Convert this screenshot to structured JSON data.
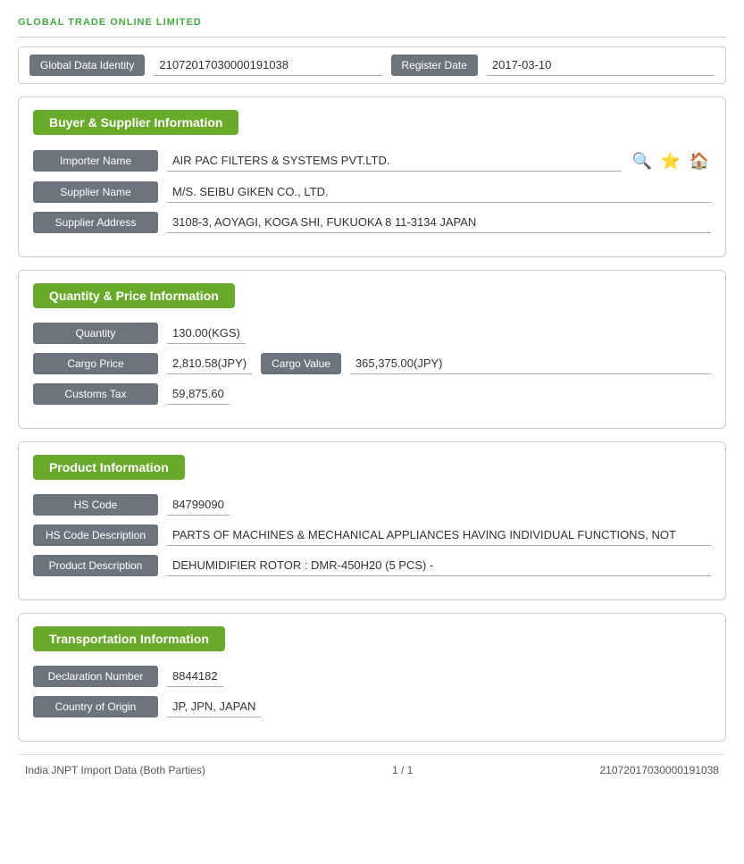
{
  "logo": {
    "text": "GLOBAL TRADE ONLINE LIMITED"
  },
  "global_id": {
    "label": "Global Data Identity",
    "value": "21072017030000191038",
    "register_label": "Register Date",
    "register_value": "2017-03-10"
  },
  "buyer_supplier": {
    "title": "Buyer & Supplier Information",
    "importer_label": "Importer Name",
    "importer_value": "AIR PAC FILTERS & SYSTEMS PVT.LTD.",
    "supplier_label": "Supplier Name",
    "supplier_value": "M/S. SEIBU GIKEN CO., LTD.",
    "address_label": "Supplier Address",
    "address_value": "3108-3, AOYAGI, KOGA SHI, FUKUOKA 8 11-3134 JAPAN",
    "icons": [
      "🔍",
      "⭐",
      "🏠"
    ]
  },
  "quantity_price": {
    "title": "Quantity & Price Information",
    "quantity_label": "Quantity",
    "quantity_value": "130.00(KGS)",
    "cargo_price_label": "Cargo Price",
    "cargo_price_value": "2,810.58(JPY)",
    "cargo_value_label": "Cargo Value",
    "cargo_value_value": "365,375.00(JPY)",
    "customs_label": "Customs Tax",
    "customs_value": "59,875.60"
  },
  "product": {
    "title": "Product Information",
    "hs_code_label": "HS Code",
    "hs_code_value": "84799090",
    "hs_desc_label": "HS Code Description",
    "hs_desc_value": "PARTS OF MACHINES & MECHANICAL APPLIANCES HAVING INDIVIDUAL FUNCTIONS, NOT",
    "prod_desc_label": "Product Description",
    "prod_desc_value": "DEHUMIDIFIER ROTOR : DMR-450H20 (5 PCS) -"
  },
  "transport": {
    "title": "Transportation Information",
    "decl_label": "Declaration Number",
    "decl_value": "8844182",
    "origin_label": "Country of Origin",
    "origin_value": "JP, JPN, JAPAN"
  },
  "footer": {
    "left": "India JNPT Import Data (Both Parties)",
    "center": "1 / 1",
    "right": "21072017030000191038"
  }
}
